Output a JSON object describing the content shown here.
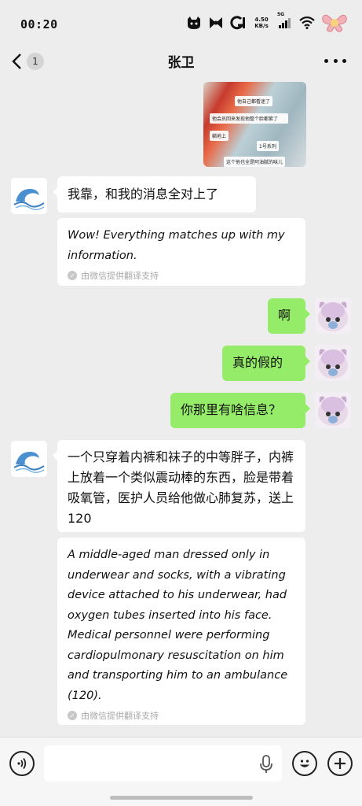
{
  "status_bar": {
    "time": "00:20",
    "net_speed_value": "4.50",
    "net_speed_unit": "KB/s",
    "signal_label": "5G",
    "icons": [
      "cat-icon",
      "bow-icon",
      "g-app-icon",
      "network-speed",
      "signal-icon",
      "wifi-icon",
      "butterfly-battery-icon"
    ]
  },
  "nav": {
    "back_icon": "chevron-left-icon",
    "unread_count": "1",
    "title": "张卫",
    "more_icon": "more-dots-icon"
  },
  "shared_image": {
    "labels": [
      "他自己都看迷了",
      "他会员回来发现他整个脸都紫了",
      "躺地上",
      "1号系列",
      "这个他也全是阿油腻的味儿"
    ]
  },
  "messages": [
    {
      "side": "received",
      "type": "text",
      "text": "我靠，和我的消息全对上了"
    },
    {
      "side": "received",
      "type": "translation",
      "text": "Wow! Everything matches up with my information.",
      "note": "由微信提供翻译支持"
    },
    {
      "side": "sent",
      "type": "text",
      "text": "啊"
    },
    {
      "side": "sent",
      "type": "text",
      "text": "真的假的"
    },
    {
      "side": "sent",
      "type": "text",
      "text": "你那里有啥信息？"
    },
    {
      "side": "received",
      "type": "text",
      "text": "一个只穿着内裤和袜子的中等胖子，内裤上放着一个类似震动棒的东西，脸是带着吸氧管，医护人员给他做心肺复苏，送上120"
    },
    {
      "side": "received",
      "type": "translation",
      "text": "A middle-aged man dressed only in underwear and socks, with a vibrating device attached to his underwear, had oxygen tubes inserted into his face. Medical personnel were performing cardiopulmonary resuscitation on him and transporting him to an ambulance (120).",
      "note": "由微信提供翻译支持"
    }
  ],
  "input_bar": {
    "voice_icon": "voice-toggle-icon",
    "field_value": "",
    "mic_icon": "microphone-icon",
    "emoji_icon": "emoji-icon",
    "plus_icon": "plus-icon"
  },
  "colors": {
    "background": "#ededed",
    "sent_bubble": "#95ec69",
    "received_bubble": "#ffffff",
    "note_text": "#a8a8a8"
  }
}
